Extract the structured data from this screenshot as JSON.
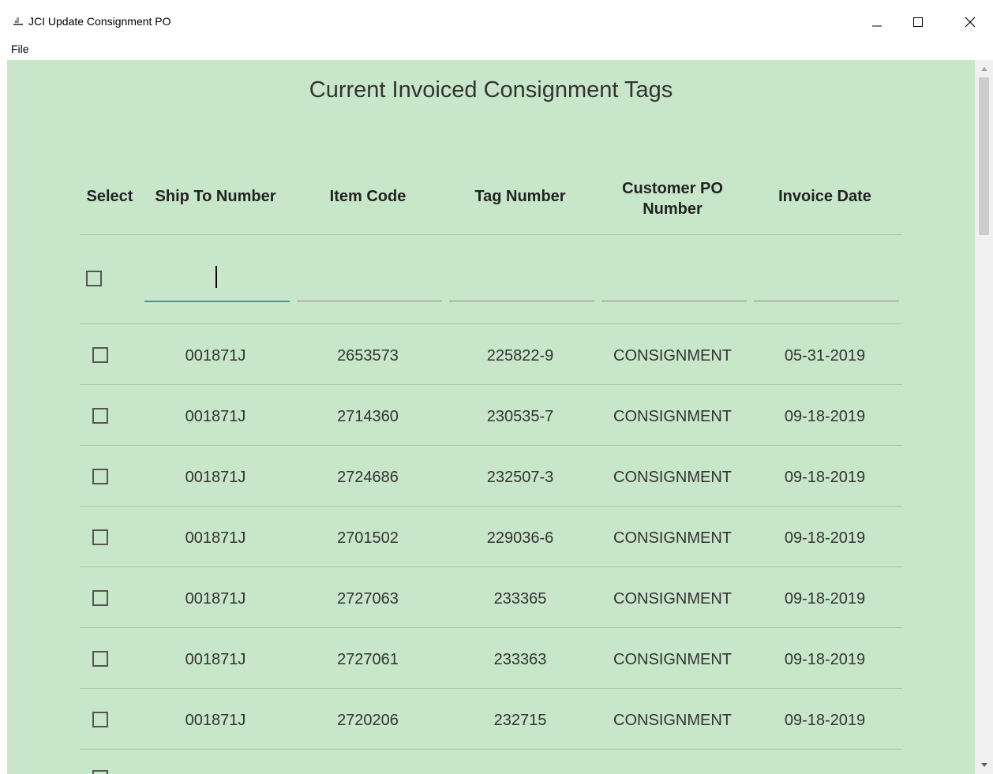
{
  "window": {
    "title": "JCI Update Consignment PO",
    "controls": {
      "minimize": "—",
      "maximize": "☐",
      "close": "✕"
    }
  },
  "menu": {
    "file": "File"
  },
  "page": {
    "title": "Current Invoiced Consignment Tags"
  },
  "table": {
    "headers": {
      "select": "Select",
      "ship_to": "Ship To Number",
      "item_code": "Item Code",
      "tag_number": "Tag Number",
      "customer_po_line1": "Customer PO",
      "customer_po_line2": "Number",
      "invoice_date": "Invoice Date"
    },
    "filters": {
      "ship_to": "",
      "item_code": "",
      "tag_number": "",
      "customer_po": "",
      "invoice_date": ""
    },
    "rows": [
      {
        "ship_to": "001871J",
        "item_code": "2653573",
        "tag_number": "225822-9",
        "customer_po": "CONSIGNMENT",
        "invoice_date": "05-31-2019"
      },
      {
        "ship_to": "001871J",
        "item_code": "2714360",
        "tag_number": "230535-7",
        "customer_po": "CONSIGNMENT",
        "invoice_date": "09-18-2019"
      },
      {
        "ship_to": "001871J",
        "item_code": "2724686",
        "tag_number": "232507-3",
        "customer_po": "CONSIGNMENT",
        "invoice_date": "09-18-2019"
      },
      {
        "ship_to": "001871J",
        "item_code": "2701502",
        "tag_number": "229036-6",
        "customer_po": "CONSIGNMENT",
        "invoice_date": "09-18-2019"
      },
      {
        "ship_to": "001871J",
        "item_code": "2727063",
        "tag_number": "233365",
        "customer_po": "CONSIGNMENT",
        "invoice_date": "09-18-2019"
      },
      {
        "ship_to": "001871J",
        "item_code": "2727061",
        "tag_number": "233363",
        "customer_po": "CONSIGNMENT",
        "invoice_date": "09-18-2019"
      },
      {
        "ship_to": "001871J",
        "item_code": "2720206",
        "tag_number": "232715",
        "customer_po": "CONSIGNMENT",
        "invoice_date": "09-18-2019"
      }
    ]
  },
  "colors": {
    "background": "#c8e6c9",
    "accent": "#26a69a"
  }
}
